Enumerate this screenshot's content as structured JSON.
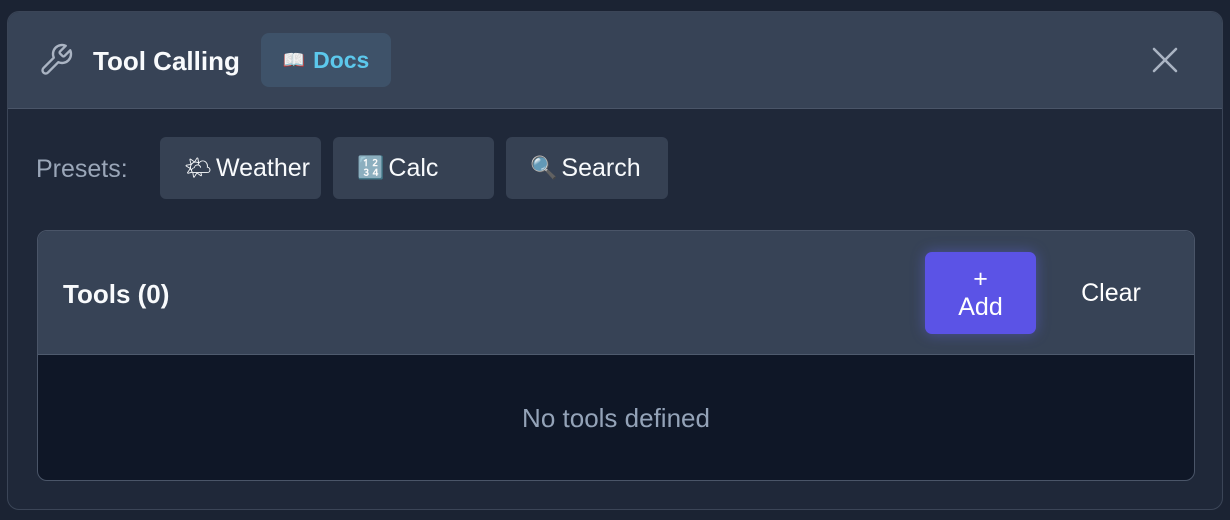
{
  "header": {
    "title": "Tool Calling",
    "docs_icon": "📖",
    "docs_label": "Docs",
    "wrench_icon": "wrench-icon",
    "close_icon": "close-icon"
  },
  "presets": {
    "label": "Presets:",
    "items": [
      {
        "emoji": "🌤",
        "label": "Weather"
      },
      {
        "emoji": "🔢",
        "label": "Calc"
      },
      {
        "emoji": "🔍",
        "label": "Search"
      }
    ]
  },
  "tools": {
    "title": "Tools (0)",
    "add_plus": "+",
    "add_label": "Add",
    "clear_label": "Clear",
    "empty_message": "No tools defined"
  },
  "colors": {
    "accent": "#5b53e6",
    "docs_text": "#5cc8ec",
    "panel_bg": "#1f2839",
    "header_bg": "#374356"
  }
}
